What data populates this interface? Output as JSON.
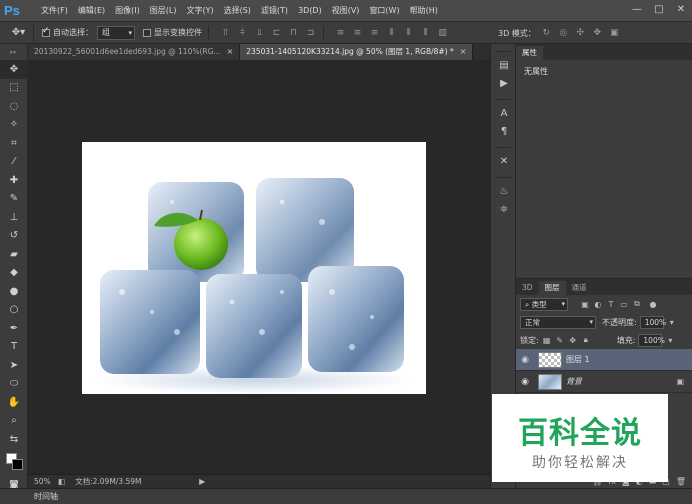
{
  "app": {
    "logo": "Ps"
  },
  "menus": [
    "文件(F)",
    "编辑(E)",
    "图像(I)",
    "图层(L)",
    "文字(Y)",
    "选择(S)",
    "滤镜(T)",
    "3D(D)",
    "视图(V)",
    "窗口(W)",
    "帮助(H)"
  ],
  "window_controls": {
    "minimize": "—",
    "restore": "□",
    "close": "✕"
  },
  "options_bar": {
    "tool_icon": "move-icon",
    "auto_select_label": "自动选择：",
    "auto_select_checked": true,
    "auto_select_value": "组",
    "show_transform_label": "显示变换控件",
    "show_transform_checked": false,
    "mode_3d_label": "3D 模式："
  },
  "tabs": [
    {
      "label": "20130922_56001d6ee1ded693.jpg @ 110%(RG...",
      "active": false
    },
    {
      "label": "235031-1405120K33214.jpg @ 50% (图层 1, RGB/8#) *",
      "active": true
    }
  ],
  "status": {
    "zoom": "50%",
    "doc_size": "文档:2.09M/3.59M"
  },
  "timeline_label": "时间轴",
  "properties_panel": {
    "tab": "属性",
    "body": "无属性"
  },
  "layers_panel": {
    "tabs": [
      "3D",
      "图层",
      "通道"
    ],
    "active_tab": "图层",
    "filter_label": "类型",
    "blend_mode": "正常",
    "opacity_label": "不透明度:",
    "opacity_value": "100%",
    "lock_label": "锁定:",
    "fill_label": "填充:",
    "fill_value": "100%",
    "layers": [
      {
        "name": "图层 1",
        "active": true
      },
      {
        "name": "背景",
        "active": false,
        "locked": true
      }
    ]
  },
  "watermark": {
    "title": "百科全说",
    "subtitle": "助你轻松解决"
  },
  "colors": {
    "accent": "#3fa8f5",
    "selection": "#596478",
    "watermark_green": "#22a55b"
  }
}
